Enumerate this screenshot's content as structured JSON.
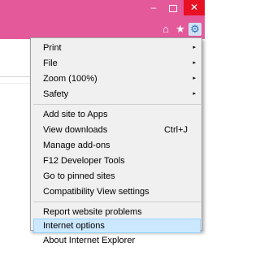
{
  "window_controls": {
    "minimize": "–",
    "close": "✕"
  },
  "toolbar": {
    "home_icon": "⌂",
    "favorites_icon": "★",
    "tools_icon": "⚙"
  },
  "menu": {
    "print": {
      "label": "Print",
      "submenu": "▸"
    },
    "file": {
      "label": "File",
      "submenu": "▸"
    },
    "zoom": {
      "label": "Zoom (100%)",
      "submenu": "▸"
    },
    "safety": {
      "label": "Safety",
      "submenu": "▸"
    },
    "add_site": {
      "label": "Add site to Apps"
    },
    "view_downloads": {
      "label": "View downloads",
      "shortcut": "Ctrl+J"
    },
    "manage_addons": {
      "label": "Manage add-ons"
    },
    "f12": {
      "label": "F12 Developer Tools"
    },
    "pinned": {
      "label": "Go to pinned sites"
    },
    "compat": {
      "label": "Compatibility View settings"
    },
    "report": {
      "label": "Report website problems"
    },
    "internet_options": {
      "label": "Internet options"
    },
    "about": {
      "label": "About Internet Explorer"
    }
  },
  "colors": {
    "title_bar": "#e3599a",
    "close_button": "#e81123",
    "menu_background": "#f0f0f0",
    "highlight": "#cce8ff"
  }
}
